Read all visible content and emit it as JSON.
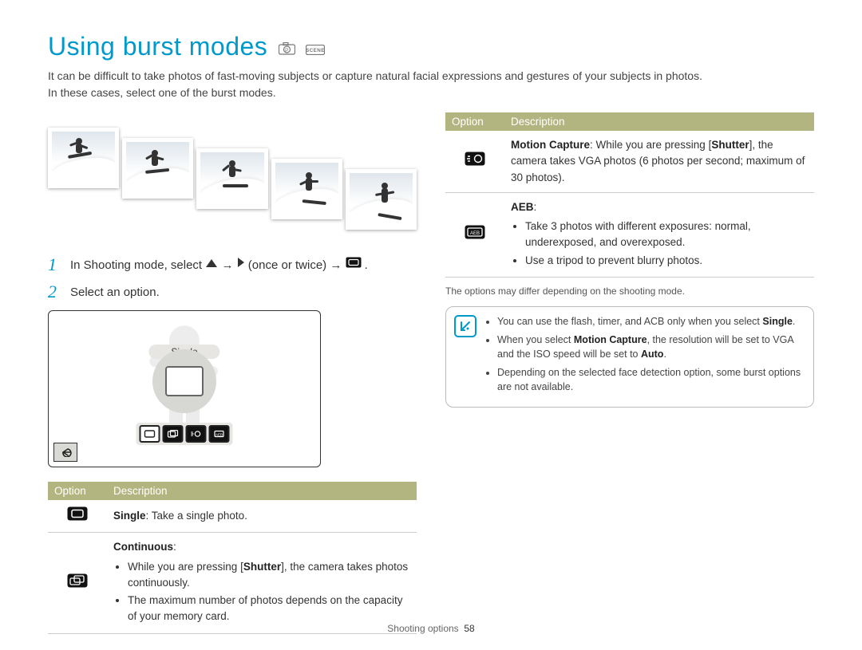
{
  "title": "Using burst modes",
  "intro_line1": "It can be difficult to take photos of fast-moving subjects or capture natural facial expressions and gestures of your subjects in photos.",
  "intro_line2": "In these cases, select one of the burst modes.",
  "steps": {
    "s1_prefix": "In Shooting mode, select ",
    "s1_mid1": " → ",
    "s1_mid2": " (once or twice) → ",
    "s1_suffix": ".",
    "s2": "Select an option."
  },
  "screen": {
    "selected_label": "Single"
  },
  "left_table": {
    "col_option": "Option",
    "col_description": "Description",
    "rows": [
      {
        "name": "Single",
        "text_after": ": Take a single photo."
      },
      {
        "name": "Continuous",
        "text_after": ":",
        "bullets": [
          "While you are pressing [Shutter], the camera takes photos continuously.",
          "The maximum number of photos depends on the capacity of your memory card."
        ]
      }
    ]
  },
  "right_table": {
    "col_option": "Option",
    "col_description": "Description",
    "rows": [
      {
        "name": "Motion Capture",
        "text": ": While you are pressing [Shutter], the camera takes VGA photos (6 photos per second; maximum of 30 photos)."
      },
      {
        "name": "AEB",
        "text_after": ":",
        "bullets": [
          "Take 3 photos with different exposures: normal, underexposed, and overexposed.",
          "Use a tripod to prevent blurry photos."
        ]
      }
    ]
  },
  "footnote_right": "The options may differ depending on the shooting mode.",
  "callout": {
    "items": [
      {
        "pre": "You can use the flash, timer, and ACB only when you select ",
        "bold": "Single",
        "post": "."
      },
      {
        "pre": "When you select ",
        "bold": "Motion Capture",
        "post": ", the resolution will be set to VGA and the ISO speed will be set to ",
        "bold2": "Auto",
        "post2": "."
      },
      {
        "pre": "Depending on the selected face detection option, some burst options are not available."
      }
    ]
  },
  "footer": {
    "section": "Shooting options",
    "page": "58"
  }
}
